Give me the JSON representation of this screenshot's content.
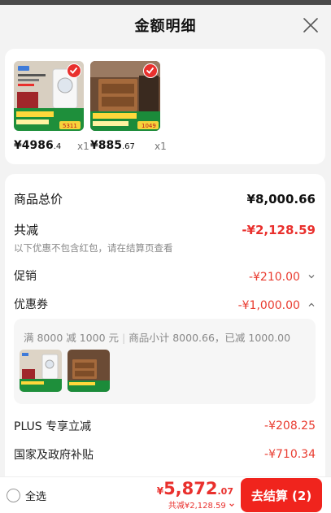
{
  "header": {
    "title": "金额明细"
  },
  "products": [
    {
      "price_int": "¥4986",
      "price_dec": ".4",
      "qty": "x1"
    },
    {
      "price_int": "¥885",
      "price_dec": ".67",
      "qty": "x1"
    }
  ],
  "summary": {
    "total_label": "商品总价",
    "total_value": "¥8,000.66",
    "discount_label": "共减",
    "discount_value": "-¥2,128.59",
    "discount_note": "以下优惠不包含红包，请在结算页查看",
    "promo_label": "促销",
    "promo_value": "-¥210.00",
    "coupon_label": "优惠券",
    "coupon_value": "-¥1,000.00",
    "coupon_detail_a": "满 8000 减 1000 元",
    "coupon_detail_b": "商品小计 8000.66，已减 1000.00",
    "plus_label": "PLUS 专享立减",
    "plus_value": "-¥208.25",
    "subsidy_label": "国家及政府补贴",
    "subsidy_value": "-¥710.34"
  },
  "bottom": {
    "select_all": "全选",
    "currency": "¥",
    "price_int": "5,872",
    "price_dec": ".07",
    "discount_text": "共减¥2,128.59",
    "checkout_label": "去结算 (2)"
  },
  "colors": {
    "accent": "#e9302d",
    "checkout": "#f0241d",
    "muted": "#888888"
  }
}
